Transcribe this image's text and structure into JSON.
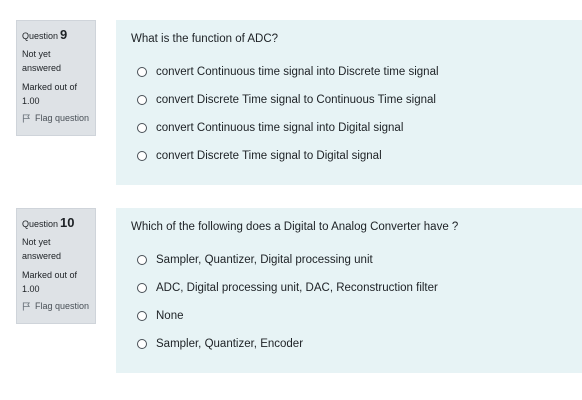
{
  "questions": [
    {
      "number_prefix": "Question",
      "number": "9",
      "state": "Not yet answered",
      "grade": "Marked out of 1.00",
      "flag_label": "Flag question",
      "text": "What is the function of ADC?",
      "answers": [
        "convert Continuous time signal into Discrete time signal",
        "convert Discrete Time signal to Continuous Time signal",
        "convert Continuous time signal into Digital signal",
        "convert Discrete Time signal to Digital signal"
      ]
    },
    {
      "number_prefix": "Question",
      "number": "10",
      "state": "Not yet answered",
      "grade": "Marked out of 1.00",
      "flag_label": "Flag question",
      "text": "Which of the following does a Digital to Analog Converter have ?",
      "answers": [
        "Sampler, Quantizer, Digital processing unit",
        "ADC, Digital processing unit, DAC, Reconstruction filter",
        "None",
        "Sampler, Quantizer, Encoder"
      ]
    }
  ],
  "colors": {
    "info_bg": "#dee2e6",
    "content_bg": "#e7f3f5",
    "text": "#1d2125"
  },
  "icons": {
    "flag": "flag-icon",
    "radio": "radio-unchecked-icon"
  }
}
